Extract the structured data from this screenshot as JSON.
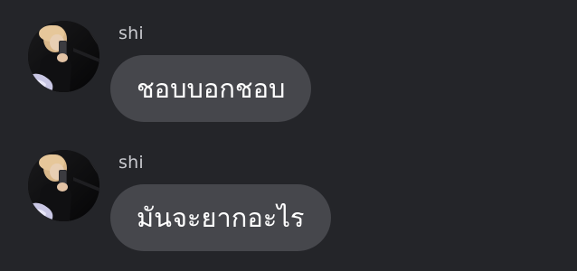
{
  "colors": {
    "background": "#242529",
    "bubble": "#46474c",
    "sender_text": "#c9cacf",
    "message_text": "#ffffff"
  },
  "messages": [
    {
      "sender": "shi",
      "text": "ชอบบอกชอบ",
      "avatar": "profile-photo-avatar"
    },
    {
      "sender": "shi",
      "text": "มันจะยากอะไร",
      "avatar": "profile-photo-avatar"
    }
  ]
}
